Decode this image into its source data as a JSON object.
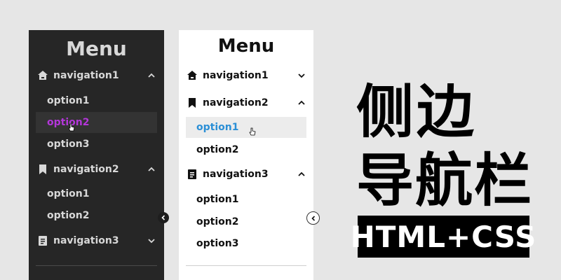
{
  "dark_menu": {
    "title": "Menu",
    "sections": [
      {
        "label": "navigation1",
        "icon": "home-icon",
        "expanded": true,
        "options": [
          "option1",
          "option2"
        ]
      },
      {
        "label": "navigation2",
        "icon": "bookmark-icon",
        "expanded": true,
        "options": [
          "option1",
          "option2"
        ]
      },
      {
        "label": "navigation3",
        "icon": "document-icon",
        "expanded": false,
        "options": []
      }
    ],
    "extra_option": "option3",
    "active_option": "option2",
    "colors": {
      "background": "#262626",
      "text": "#d8d8d8",
      "active_text": "#b336d9",
      "active_bg": "#333333"
    }
  },
  "light_menu": {
    "title": "Menu",
    "sections": [
      {
        "label": "navigation1",
        "icon": "home-icon",
        "expanded": false,
        "options": []
      },
      {
        "label": "navigation2",
        "icon": "bookmark-icon",
        "expanded": true,
        "options": [
          "option1",
          "option2"
        ]
      },
      {
        "label": "navigation3",
        "icon": "document-icon",
        "expanded": true,
        "options": [
          "option1",
          "option2",
          "option3"
        ]
      }
    ],
    "active_option": "option1",
    "colors": {
      "background": "#ffffff",
      "text": "#111111",
      "active_text": "#2b8fd6",
      "active_bg": "#ececec"
    }
  },
  "caption": {
    "line1": "侧边",
    "line2": "导航栏",
    "line3": "HTML+CSS"
  }
}
